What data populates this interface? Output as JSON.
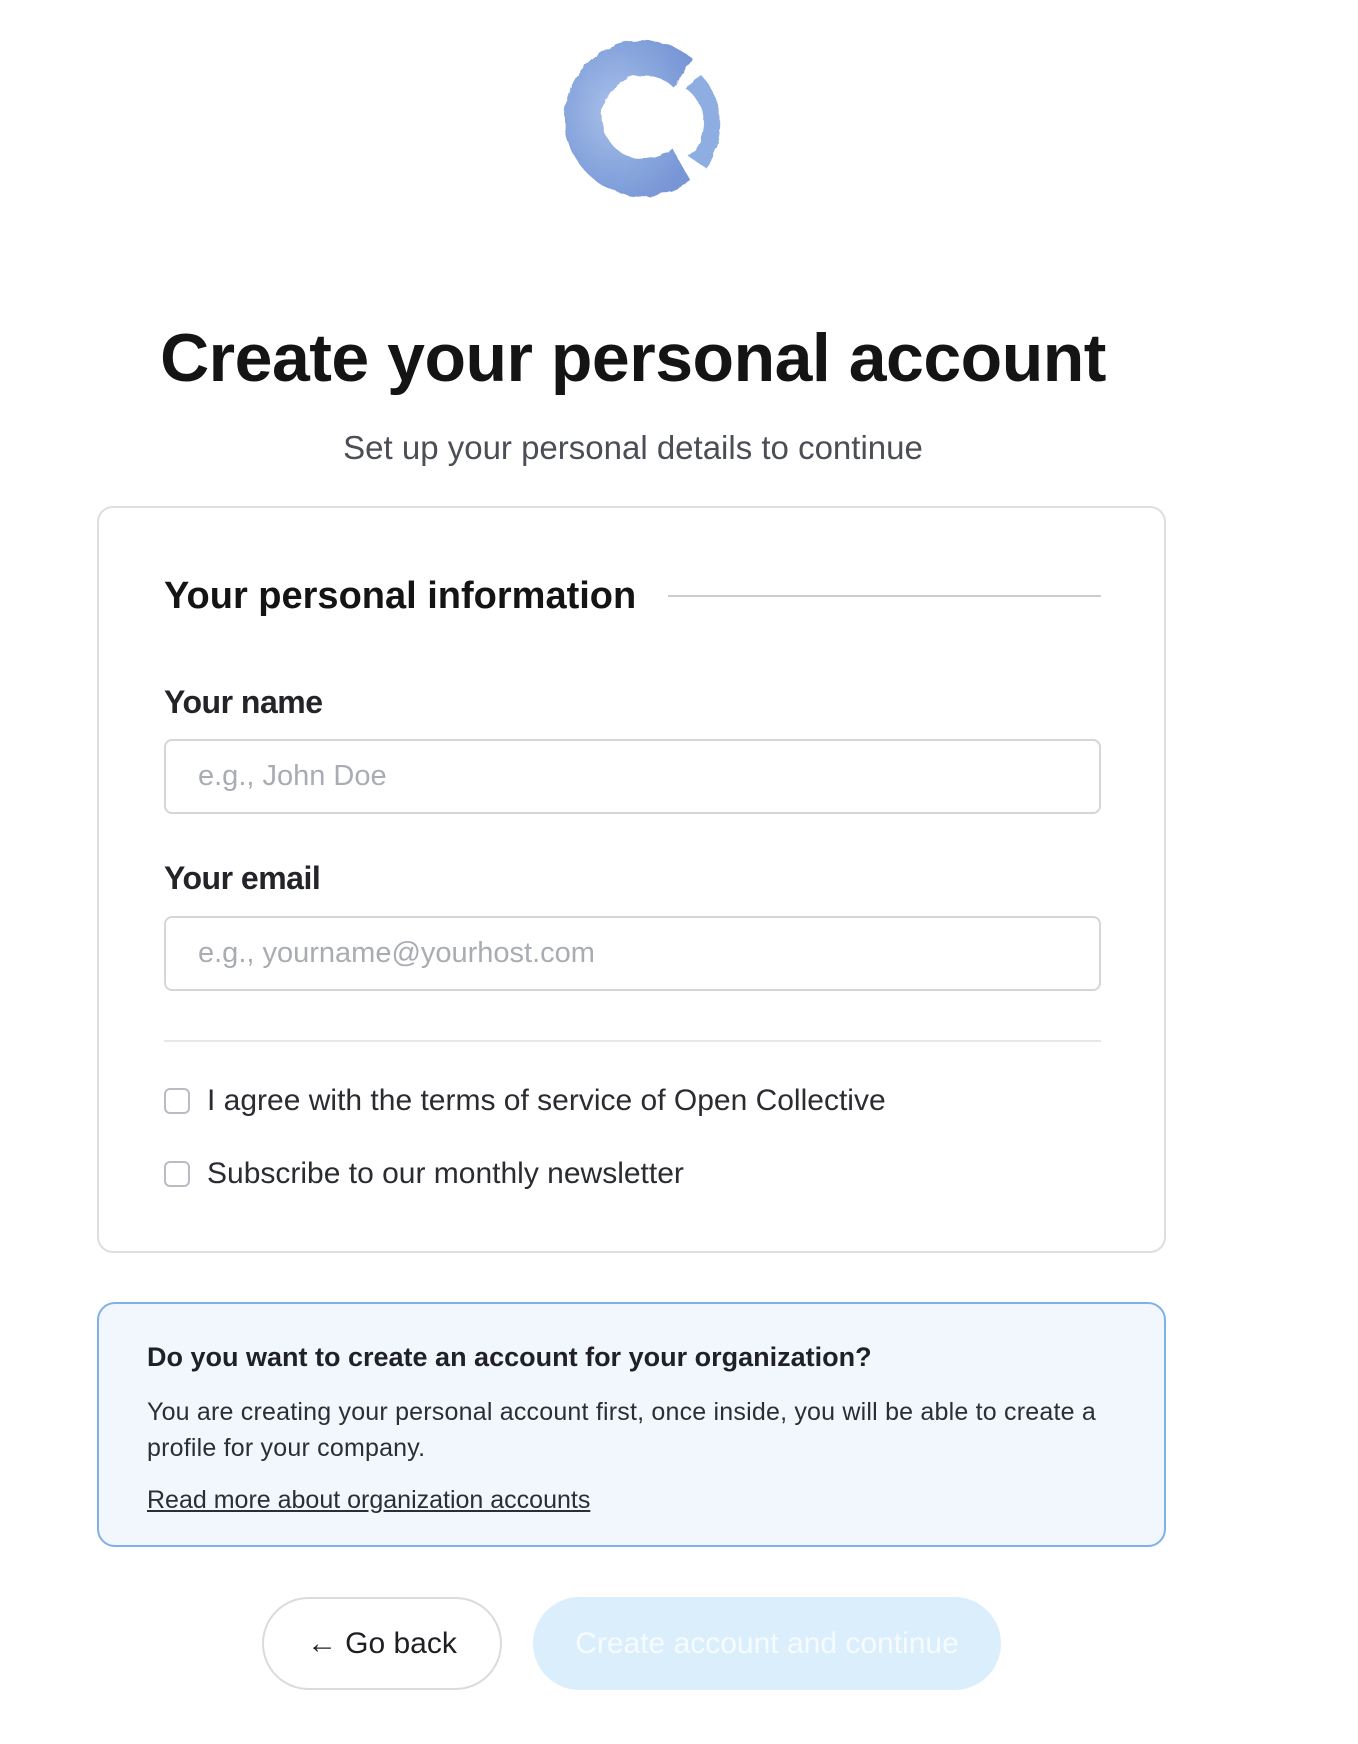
{
  "brand": {
    "logo_icon": "open-collective-logo-icon",
    "logo_color": "#8aa8dc"
  },
  "header": {
    "title": "Create your personal account",
    "subtitle": "Set up your personal details to continue"
  },
  "form": {
    "section_title": "Your personal information",
    "name": {
      "label": "Your name",
      "value": "",
      "placeholder": "e.g., John Doe"
    },
    "email": {
      "label": "Your email",
      "value": "",
      "placeholder": "e.g., yourname@yourhost.com"
    },
    "checkboxes": [
      {
        "label": "I agree with the terms of service of Open Collective",
        "checked": false
      },
      {
        "label": "Subscribe to our monthly newsletter",
        "checked": false
      }
    ]
  },
  "info": {
    "title": "Do you want to create an account for your organization?",
    "body": "You are creating your personal account first, once inside, you will be able to create a profile for your company.",
    "link": "Read more about organization accounts",
    "border_color": "#7fb0e8",
    "background_color": "#f2f7fd"
  },
  "actions": {
    "back_arrow": "←",
    "back_label": "Go back",
    "back_icon": "arrow-left-icon",
    "create_label": "Create account and continue",
    "create_disabled": true,
    "create_color": "#dbeefc"
  }
}
